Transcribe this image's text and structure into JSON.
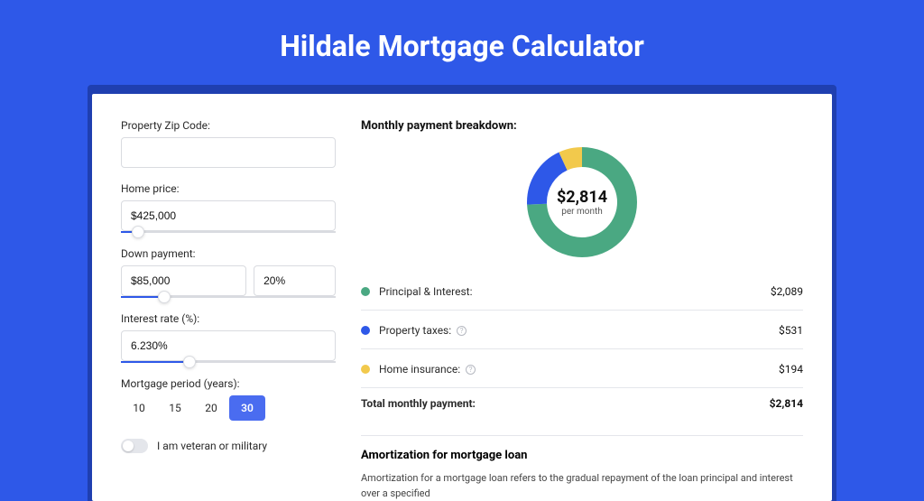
{
  "title": "Hildale Mortgage Calculator",
  "form": {
    "zip": {
      "label": "Property Zip Code:",
      "value": ""
    },
    "home_price": {
      "label": "Home price:",
      "value": "$425,000",
      "slider_pct": 8
    },
    "down_payment": {
      "label": "Down payment:",
      "amount": "$85,000",
      "pct": "20%",
      "slider_pct": 20
    },
    "interest_rate": {
      "label": "Interest rate (%):",
      "value": "6.230%",
      "slider_pct": 32
    },
    "period": {
      "label": "Mortgage period (years):",
      "options": [
        "10",
        "15",
        "20",
        "30"
      ],
      "selected": "30"
    },
    "veteran": {
      "label": "I am veteran or military",
      "checked": false
    }
  },
  "breakdown": {
    "title": "Monthly payment breakdown:",
    "center_amount": "$2,814",
    "center_sub": "per month",
    "items": [
      {
        "label": "Principal & Interest:",
        "value": "$2,089",
        "color": "#4aa882",
        "info": false
      },
      {
        "label": "Property taxes:",
        "value": "$531",
        "color": "#2e58e8",
        "info": true
      },
      {
        "label": "Home insurance:",
        "value": "$194",
        "color": "#f2c94c",
        "info": true
      }
    ],
    "total_label": "Total monthly payment:",
    "total_value": "$2,814"
  },
  "amortization": {
    "title": "Amortization for mortgage loan",
    "text": "Amortization for a mortgage loan refers to the gradual repayment of the loan principal and interest over a specified"
  },
  "chart_data": {
    "type": "pie",
    "title": "Monthly payment breakdown",
    "series": [
      {
        "name": "Principal & Interest",
        "value": 2089,
        "color": "#4aa882"
      },
      {
        "name": "Property taxes",
        "value": 531,
        "color": "#2e58e8"
      },
      {
        "name": "Home insurance",
        "value": 194,
        "color": "#f2c94c"
      }
    ],
    "total": 2814,
    "center_label": "$2,814 per month"
  }
}
